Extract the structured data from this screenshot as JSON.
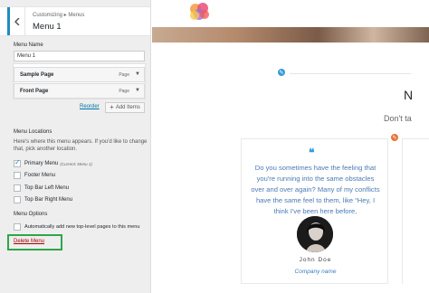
{
  "sidebar": {
    "breadcrumb": "Customizing ▸ Menus",
    "title": "Menu 1",
    "menu_name_label": "Menu Name",
    "menu_name_value": "Menu 1",
    "items": [
      {
        "label": "Sample Page",
        "type": "Page"
      },
      {
        "label": "Front Page",
        "type": "Page"
      }
    ],
    "reorder_label": "Reorder",
    "add_items_label": "Add Items",
    "locations_heading": "Menu Locations",
    "locations_description": "Here's where this menu appears. If you'd like to change that, pick another location.",
    "locations": [
      {
        "label": "Primary Menu",
        "note": "(Current: Menu 1)",
        "checked": true
      },
      {
        "label": "Footer Menu",
        "note": "",
        "checked": false
      },
      {
        "label": "Top Bar Left Menu",
        "note": "",
        "checked": false
      },
      {
        "label": "Top Bar Right Menu",
        "note": "",
        "checked": false
      }
    ],
    "options_heading": "Menu Options",
    "auto_add_label": "Automatically add new top-level pages to this menu",
    "delete_label": "Delete Menu",
    "highlight_color": "#2fa64a"
  },
  "preview": {
    "heading_partial": "N",
    "subheading_partial": "Don't ta",
    "testimonial": {
      "quote": "Do you sometimes have the feeling that you're running into the same obstacles over and over again? Many of my conflicts have the same feel to them, like “Hey, I think I've been here before,",
      "name": "John Doe",
      "company": "Company name"
    }
  },
  "colors": {
    "accent": "#1e8cbe",
    "shortcut_blue": "#3a9ad9",
    "shortcut_orange": "#e8733a"
  }
}
